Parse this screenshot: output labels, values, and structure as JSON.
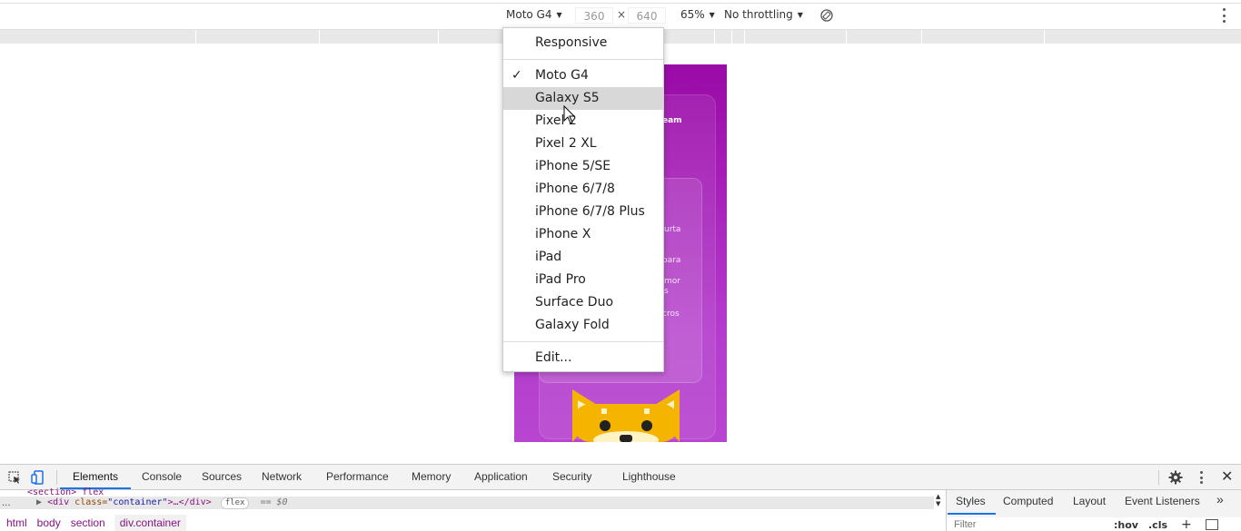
{
  "device_toolbar": {
    "device": "Moto G4",
    "width": "360",
    "times": "×",
    "height": "640",
    "zoom": "65%",
    "throttling": "No throttling"
  },
  "dropdown": {
    "responsive": "Responsive",
    "checkmark": "✓",
    "devices": [
      "Moto G4",
      "Galaxy S5",
      "Pixel 2",
      "Pixel 2 XL",
      "iPhone 5/SE",
      "iPhone 6/7/8",
      "iPhone 6/7/8 Plus",
      "iPhone X",
      "iPad",
      "iPad Pro",
      "Surface Duo",
      "Galaxy Fold"
    ],
    "selected": "Moto G4",
    "hovered": "Galaxy S5",
    "edit": "Edit..."
  },
  "phone_page": {
    "fragments": [
      "eam",
      "urta",
      "para",
      "mor",
      "s",
      "cros"
    ]
  },
  "devtools": {
    "tabs": [
      "Elements",
      "Console",
      "Sources",
      "Network",
      "Performance",
      "Memory",
      "Application",
      "Security",
      "Lighthouse"
    ],
    "active_tab": "Elements",
    "elements": {
      "prev_line": "<section> flex",
      "ellipsis": "...",
      "code_open": "<div ",
      "code_attr": "class=",
      "code_val": "\"container\"",
      "code_close": ">…</div>",
      "badge": "flex",
      "selected_marker": "== $0"
    },
    "breadcrumbs": [
      "html",
      "body",
      "section",
      "div.container"
    ],
    "styles_tabs": [
      "Styles",
      "Computed",
      "Layout",
      "Event Listeners"
    ],
    "styles_more": "»",
    "filter_placeholder": "Filter",
    "hov": ":hov",
    "cls": ".cls",
    "plus": "+"
  },
  "colors": {
    "accent": "#1a73e8",
    "phone_top": "#9a0aa6",
    "phone_bottom": "#b845d0",
    "cat": "#f5b400"
  }
}
